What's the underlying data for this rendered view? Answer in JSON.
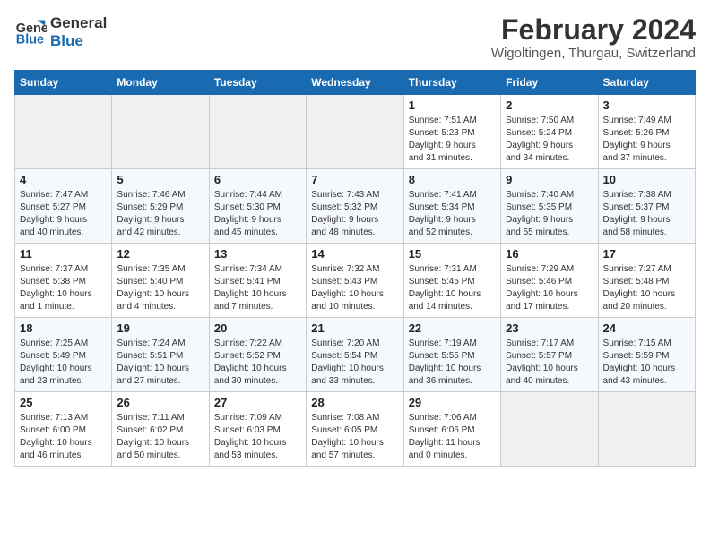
{
  "header": {
    "logo_line1": "General",
    "logo_line2": "Blue",
    "month": "February 2024",
    "location": "Wigoltingen, Thurgau, Switzerland"
  },
  "days_of_week": [
    "Sunday",
    "Monday",
    "Tuesday",
    "Wednesday",
    "Thursday",
    "Friday",
    "Saturday"
  ],
  "weeks": [
    [
      {
        "day": "",
        "info": ""
      },
      {
        "day": "",
        "info": ""
      },
      {
        "day": "",
        "info": ""
      },
      {
        "day": "",
        "info": ""
      },
      {
        "day": "1",
        "info": "Sunrise: 7:51 AM\nSunset: 5:23 PM\nDaylight: 9 hours\nand 31 minutes."
      },
      {
        "day": "2",
        "info": "Sunrise: 7:50 AM\nSunset: 5:24 PM\nDaylight: 9 hours\nand 34 minutes."
      },
      {
        "day": "3",
        "info": "Sunrise: 7:49 AM\nSunset: 5:26 PM\nDaylight: 9 hours\nand 37 minutes."
      }
    ],
    [
      {
        "day": "4",
        "info": "Sunrise: 7:47 AM\nSunset: 5:27 PM\nDaylight: 9 hours\nand 40 minutes."
      },
      {
        "day": "5",
        "info": "Sunrise: 7:46 AM\nSunset: 5:29 PM\nDaylight: 9 hours\nand 42 minutes."
      },
      {
        "day": "6",
        "info": "Sunrise: 7:44 AM\nSunset: 5:30 PM\nDaylight: 9 hours\nand 45 minutes."
      },
      {
        "day": "7",
        "info": "Sunrise: 7:43 AM\nSunset: 5:32 PM\nDaylight: 9 hours\nand 48 minutes."
      },
      {
        "day": "8",
        "info": "Sunrise: 7:41 AM\nSunset: 5:34 PM\nDaylight: 9 hours\nand 52 minutes."
      },
      {
        "day": "9",
        "info": "Sunrise: 7:40 AM\nSunset: 5:35 PM\nDaylight: 9 hours\nand 55 minutes."
      },
      {
        "day": "10",
        "info": "Sunrise: 7:38 AM\nSunset: 5:37 PM\nDaylight: 9 hours\nand 58 minutes."
      }
    ],
    [
      {
        "day": "11",
        "info": "Sunrise: 7:37 AM\nSunset: 5:38 PM\nDaylight: 10 hours\nand 1 minute."
      },
      {
        "day": "12",
        "info": "Sunrise: 7:35 AM\nSunset: 5:40 PM\nDaylight: 10 hours\nand 4 minutes."
      },
      {
        "day": "13",
        "info": "Sunrise: 7:34 AM\nSunset: 5:41 PM\nDaylight: 10 hours\nand 7 minutes."
      },
      {
        "day": "14",
        "info": "Sunrise: 7:32 AM\nSunset: 5:43 PM\nDaylight: 10 hours\nand 10 minutes."
      },
      {
        "day": "15",
        "info": "Sunrise: 7:31 AM\nSunset: 5:45 PM\nDaylight: 10 hours\nand 14 minutes."
      },
      {
        "day": "16",
        "info": "Sunrise: 7:29 AM\nSunset: 5:46 PM\nDaylight: 10 hours\nand 17 minutes."
      },
      {
        "day": "17",
        "info": "Sunrise: 7:27 AM\nSunset: 5:48 PM\nDaylight: 10 hours\nand 20 minutes."
      }
    ],
    [
      {
        "day": "18",
        "info": "Sunrise: 7:25 AM\nSunset: 5:49 PM\nDaylight: 10 hours\nand 23 minutes."
      },
      {
        "day": "19",
        "info": "Sunrise: 7:24 AM\nSunset: 5:51 PM\nDaylight: 10 hours\nand 27 minutes."
      },
      {
        "day": "20",
        "info": "Sunrise: 7:22 AM\nSunset: 5:52 PM\nDaylight: 10 hours\nand 30 minutes."
      },
      {
        "day": "21",
        "info": "Sunrise: 7:20 AM\nSunset: 5:54 PM\nDaylight: 10 hours\nand 33 minutes."
      },
      {
        "day": "22",
        "info": "Sunrise: 7:19 AM\nSunset: 5:55 PM\nDaylight: 10 hours\nand 36 minutes."
      },
      {
        "day": "23",
        "info": "Sunrise: 7:17 AM\nSunset: 5:57 PM\nDaylight: 10 hours\nand 40 minutes."
      },
      {
        "day": "24",
        "info": "Sunrise: 7:15 AM\nSunset: 5:59 PM\nDaylight: 10 hours\nand 43 minutes."
      }
    ],
    [
      {
        "day": "25",
        "info": "Sunrise: 7:13 AM\nSunset: 6:00 PM\nDaylight: 10 hours\nand 46 minutes."
      },
      {
        "day": "26",
        "info": "Sunrise: 7:11 AM\nSunset: 6:02 PM\nDaylight: 10 hours\nand 50 minutes."
      },
      {
        "day": "27",
        "info": "Sunrise: 7:09 AM\nSunset: 6:03 PM\nDaylight: 10 hours\nand 53 minutes."
      },
      {
        "day": "28",
        "info": "Sunrise: 7:08 AM\nSunset: 6:05 PM\nDaylight: 10 hours\nand 57 minutes."
      },
      {
        "day": "29",
        "info": "Sunrise: 7:06 AM\nSunset: 6:06 PM\nDaylight: 11 hours\nand 0 minutes."
      },
      {
        "day": "",
        "info": ""
      },
      {
        "day": "",
        "info": ""
      }
    ]
  ]
}
